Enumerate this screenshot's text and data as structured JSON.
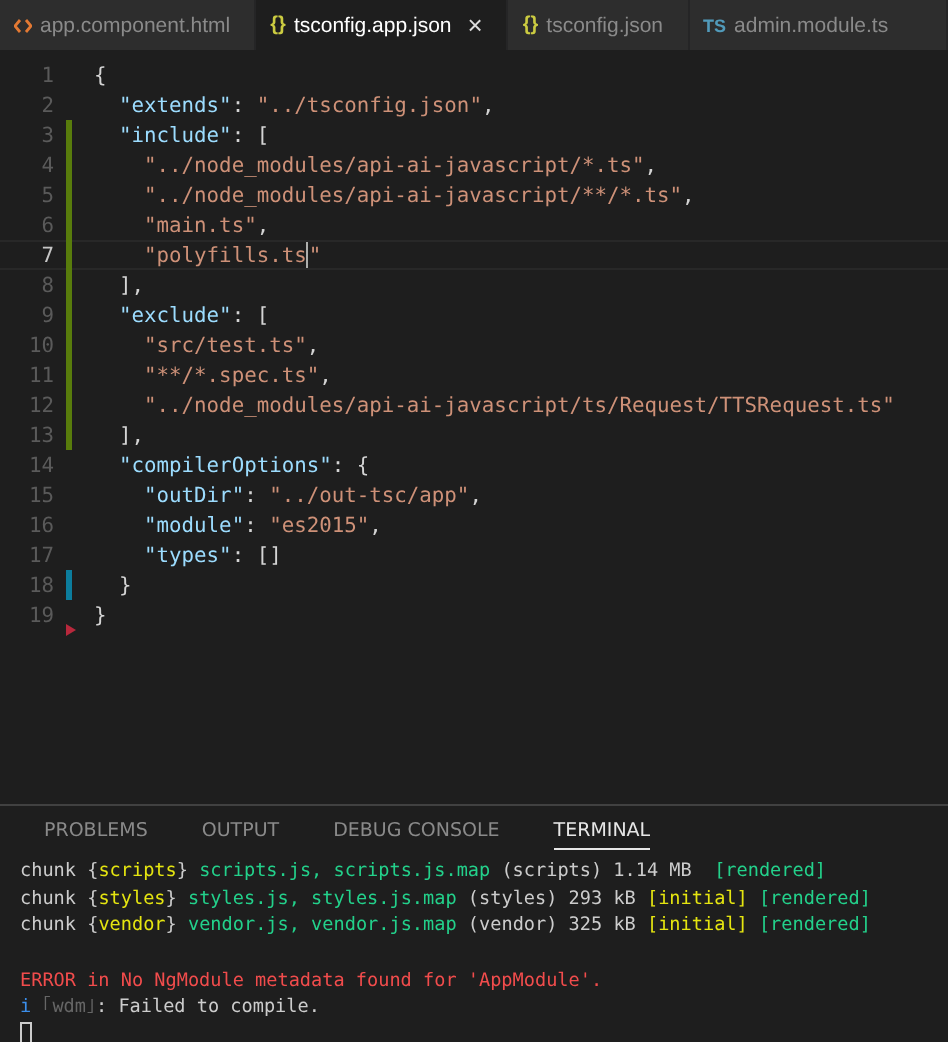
{
  "tabs": [
    {
      "label": "app.component.html",
      "selected": false,
      "kind": "html"
    },
    {
      "label": "tsconfig.app.json",
      "selected": true,
      "kind": "json",
      "icon": "{}",
      "close": "×"
    },
    {
      "label": "tsconfig.json",
      "selected": false,
      "kind": "json",
      "icon": "{}"
    },
    {
      "label": "admin.module.ts",
      "selected": false,
      "kind": "ts",
      "icon": "TS"
    }
  ],
  "editor": {
    "lines": [
      {
        "number": "1",
        "current": false,
        "kind": "unchanged",
        "tokens": [
          {
            "kind": "punct",
            "text": "{"
          }
        ]
      },
      {
        "number": "2",
        "current": false,
        "kind": "unchanged",
        "tokens": [
          {
            "kind": "key",
            "text": "  \"extends\""
          },
          {
            "kind": "punct",
            "text": ": "
          },
          {
            "kind": "string",
            "text": "\"../tsconfig.json\""
          },
          {
            "kind": "punct",
            "text": ","
          }
        ]
      },
      {
        "number": "3",
        "current": false,
        "kind": "modified",
        "tokens": [
          {
            "kind": "key",
            "text": "  \"include\""
          },
          {
            "kind": "punct",
            "text": ": ["
          }
        ]
      },
      {
        "number": "4",
        "current": false,
        "kind": "modified",
        "tokens": [
          {
            "kind": "string",
            "text": "    \"../node_modules/api-ai-javascript/*.ts\""
          },
          {
            "kind": "punct",
            "text": ","
          }
        ]
      },
      {
        "number": "5",
        "current": false,
        "kind": "modified",
        "tokens": [
          {
            "kind": "string",
            "text": "    \"../node_modules/api-ai-javascript/**/*.ts\""
          },
          {
            "kind": "punct",
            "text": ","
          }
        ]
      },
      {
        "number": "6",
        "current": false,
        "kind": "modified",
        "tokens": [
          {
            "kind": "string",
            "text": "    \"main.ts\""
          },
          {
            "kind": "punct",
            "text": ","
          }
        ]
      },
      {
        "number": "7",
        "current": true,
        "kind": "modified",
        "tokens": [
          {
            "kind": "string",
            "text": "    \"polyfills.ts"
          },
          {
            "kind": "cursor"
          },
          {
            "kind": "string",
            "text": "\""
          }
        ]
      },
      {
        "number": "8",
        "current": false,
        "kind": "modified",
        "tokens": [
          {
            "kind": "punct",
            "text": "  ],"
          }
        ]
      },
      {
        "number": "9",
        "current": false,
        "kind": "modified",
        "tokens": [
          {
            "kind": "key",
            "text": "  \"exclude\""
          },
          {
            "kind": "punct",
            "text": ": ["
          }
        ]
      },
      {
        "number": "10",
        "current": false,
        "kind": "modified",
        "tokens": [
          {
            "kind": "string",
            "text": "    \"src/test.ts\""
          },
          {
            "kind": "punct",
            "text": ","
          }
        ]
      },
      {
        "number": "11",
        "current": false,
        "kind": "modified",
        "tokens": [
          {
            "kind": "string",
            "text": "    \"**/*.spec.ts\""
          },
          {
            "kind": "punct",
            "text": ","
          }
        ]
      },
      {
        "number": "12",
        "current": false,
        "kind": "modified",
        "tokens": [
          {
            "kind": "string",
            "text": "    \"../node_modules/api-ai-javascript/ts/Request/TTSRequest.ts\""
          }
        ]
      },
      {
        "number": "13",
        "current": false,
        "kind": "modified",
        "tokens": [
          {
            "kind": "punct",
            "text": "  ],"
          }
        ]
      },
      {
        "number": "14",
        "current": false,
        "kind": "unchanged",
        "tokens": [
          {
            "kind": "key",
            "text": "  \"compilerOptions\""
          },
          {
            "kind": "punct",
            "text": ": {"
          }
        ]
      },
      {
        "number": "15",
        "current": false,
        "kind": "unchanged",
        "tokens": [
          {
            "kind": "key",
            "text": "    \"outDir\""
          },
          {
            "kind": "punct",
            "text": ": "
          },
          {
            "kind": "string",
            "text": "\"../out-tsc/app\""
          },
          {
            "kind": "punct",
            "text": ","
          }
        ]
      },
      {
        "number": "16",
        "current": false,
        "kind": "unchanged",
        "tokens": [
          {
            "kind": "key",
            "text": "    \"module\""
          },
          {
            "kind": "punct",
            "text": ": "
          },
          {
            "kind": "string",
            "text": "\"es2015\""
          },
          {
            "kind": "punct",
            "text": ","
          }
        ]
      },
      {
        "number": "17",
        "current": false,
        "kind": "unchanged",
        "tokens": [
          {
            "kind": "key",
            "text": "    \"types\""
          },
          {
            "kind": "punct",
            "text": ": []"
          }
        ]
      },
      {
        "number": "18",
        "current": false,
        "kind": "added",
        "tokens": [
          {
            "kind": "punct",
            "text": "  }"
          }
        ]
      },
      {
        "number": "19",
        "current": false,
        "kind": "deleted",
        "tokens": [
          {
            "kind": "punct",
            "text": "}"
          }
        ]
      }
    ]
  },
  "panel": {
    "tabs": [
      {
        "label": "PROBLEMS",
        "selected": false
      },
      {
        "label": "OUTPUT",
        "selected": false
      },
      {
        "label": "DEBUG CONSOLE",
        "selected": false
      },
      {
        "label": "TERMINAL",
        "selected": true
      }
    ],
    "terminal": [
      [
        {
          "kind": "plain",
          "text": "chunk {"
        },
        {
          "kind": "yellow",
          "text": "scripts"
        },
        {
          "kind": "plain",
          "text": "} "
        },
        {
          "kind": "green",
          "text": "scripts.js, scripts.js.map"
        },
        {
          "kind": "plain",
          "text": " (scripts) 1.14 MB  "
        },
        {
          "kind": "green",
          "text": "[rendered]"
        }
      ],
      [
        {
          "kind": "plain",
          "text": "chunk {"
        },
        {
          "kind": "yellow",
          "text": "styles"
        },
        {
          "kind": "plain",
          "text": "} "
        },
        {
          "kind": "green",
          "text": "styles.js, styles.js.map"
        },
        {
          "kind": "plain",
          "text": " (styles) 293 kB "
        },
        {
          "kind": "yellow",
          "text": "[initial]"
        },
        {
          "kind": "green",
          "text": " [rendered]"
        }
      ],
      [
        {
          "kind": "plain",
          "text": "chunk {"
        },
        {
          "kind": "yellow",
          "text": "vendor"
        },
        {
          "kind": "plain",
          "text": "} "
        },
        {
          "kind": "green",
          "text": "vendor.js, vendor.js.map"
        },
        {
          "kind": "plain",
          "text": " (vendor) 325 kB "
        },
        {
          "kind": "yellow",
          "text": "[initial]"
        },
        {
          "kind": "green",
          "text": " [rendered]"
        }
      ],
      [
        {
          "kind": "blank"
        }
      ],
      [
        {
          "kind": "red",
          "text": "ERROR in No NgModule metadata found for 'AppModule'."
        }
      ],
      [
        {
          "kind": "blue",
          "text": "i"
        },
        {
          "kind": "dim",
          "text": " ｢wdm｣"
        },
        {
          "kind": "plain",
          "text": ": Failed to compile."
        }
      ],
      [
        {
          "kind": "cursor"
        }
      ]
    ]
  }
}
